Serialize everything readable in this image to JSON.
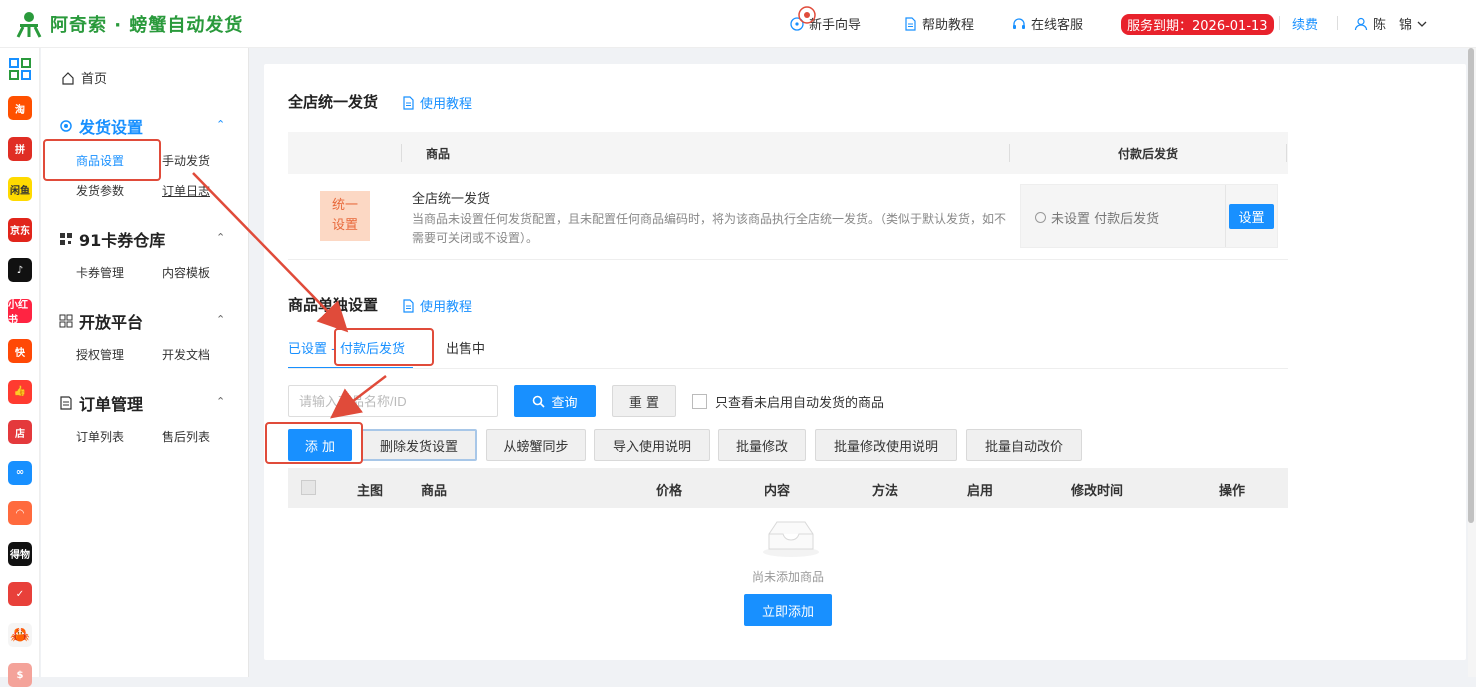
{
  "header": {
    "brand": "阿奇索 · 螃蟹自动发货",
    "nav": {
      "guide": "新手向导",
      "help": "帮助教程",
      "service": "在线客服",
      "expiry": "服务到期：2026-01-13",
      "renew": "续费",
      "user": "陈",
      "user_suffix": "锦"
    }
  },
  "apps": [
    {
      "icon": "taobao-icon",
      "label": "淘",
      "color": "#ff5000"
    },
    {
      "icon": "pinduoduo-icon",
      "label": "拼",
      "color": "#e02e24"
    },
    {
      "icon": "xianyu-icon",
      "label": "闲鱼",
      "color": "#ffda00"
    },
    {
      "icon": "jd-icon",
      "label": "京东",
      "color": "#e1251b"
    },
    {
      "icon": "douyin-icon",
      "label": "♪",
      "color": "#111111"
    },
    {
      "icon": "xiaohongshu-icon",
      "label": "小红书",
      "color": "#ff2442"
    },
    {
      "icon": "kuaishou-icon",
      "label": "快",
      "color": "#ff4906"
    },
    {
      "icon": "thumb-icon",
      "label": "👍",
      "color": "#ff3b30"
    },
    {
      "icon": "dian-icon",
      "label": "店",
      "color": "#e4393c"
    },
    {
      "icon": "link-icon",
      "label": "∞",
      "color": "#1890ff"
    },
    {
      "icon": "shop-icon",
      "label": "◠",
      "color": "#ff6a3d"
    },
    {
      "icon": "dewu-icon",
      "label": "得物",
      "color": "#111111"
    },
    {
      "icon": "mail-icon",
      "label": "✓",
      "color": "#e8403a"
    },
    {
      "icon": "crab-icon",
      "label": "🦀",
      "color": "#f5f5f5"
    },
    {
      "icon": "bag-icon",
      "label": "$",
      "color": "#f4a39a"
    }
  ],
  "sidebar": {
    "home": "首页",
    "groups": [
      {
        "title": "发货设置",
        "items": [
          "商品设置",
          "手动发货",
          "发货参数",
          "订单日志"
        ]
      },
      {
        "title": "91卡券仓库",
        "items": [
          "卡券管理",
          "内容模板"
        ]
      },
      {
        "title": "开放平台",
        "items": [
          "授权管理",
          "开发文档"
        ]
      },
      {
        "title": "订单管理",
        "items": [
          "订单列表",
          "售后列表"
        ]
      }
    ]
  },
  "global": {
    "title": "全店统一发货",
    "tutorial": "使用教程",
    "col_product": "商品",
    "col_after_pay": "付款后发货",
    "tag": "统一设置",
    "tag_line1": "统一",
    "tag_line2": "设置",
    "row_name": "全店统一发货",
    "row_desc": "当商品未设置任何发货配置，且未配置任何商品编码时，将为该商品执行全店统一发货。（类似于默认发货，如不需要可关闭或不设置）。",
    "status": "未设置 付款后发货",
    "set_button": "设置"
  },
  "single": {
    "title": "商品单独设置",
    "tutorial": "使用教程",
    "tab_set": "已设置 - 付款后发货",
    "tab_set_a": "已设置 -",
    "tab_set_b": "付款后发货",
    "tab_sale": "出售中",
    "search_placeholder": "请输入商品名称/ID",
    "query": "查询",
    "reset": "重 置",
    "only_unenabled": "只查看未启用自动发货的商品",
    "buttons": {
      "add": "添 加",
      "delete": "删除发货设置",
      "sync": "从螃蟹同步",
      "import": "导入使用说明",
      "batch_edit": "批量修改",
      "batch_edit_desc": "批量修改使用说明",
      "batch_price": "批量自动改价"
    },
    "columns": [
      "主图",
      "商品",
      "价格",
      "内容",
      "方法",
      "启用",
      "修改时间",
      "操作"
    ],
    "empty_text": "尚未添加商品",
    "add_now": "立即添加"
  }
}
